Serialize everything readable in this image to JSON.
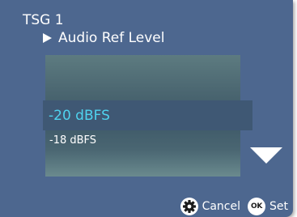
{
  "header": {
    "title": "TSG 1",
    "breadcrumb": "Audio Ref Level"
  },
  "picker": {
    "selected_value": "-20 dBFS",
    "next_value": "-18 dBFS"
  },
  "footer": {
    "cancel_label": "Cancel",
    "set_label": "Set",
    "ok_glyph": "OK"
  },
  "icons": {
    "breadcrumb": "play-arrow-icon",
    "scroll": "triangle-down-icon",
    "cancel": "gear-icon",
    "set": "ok-button-icon"
  },
  "colors": {
    "background": "#4d678f",
    "selected_text": "#4fd3ef",
    "selected_row": "#3f5874",
    "text": "#ffffff"
  }
}
